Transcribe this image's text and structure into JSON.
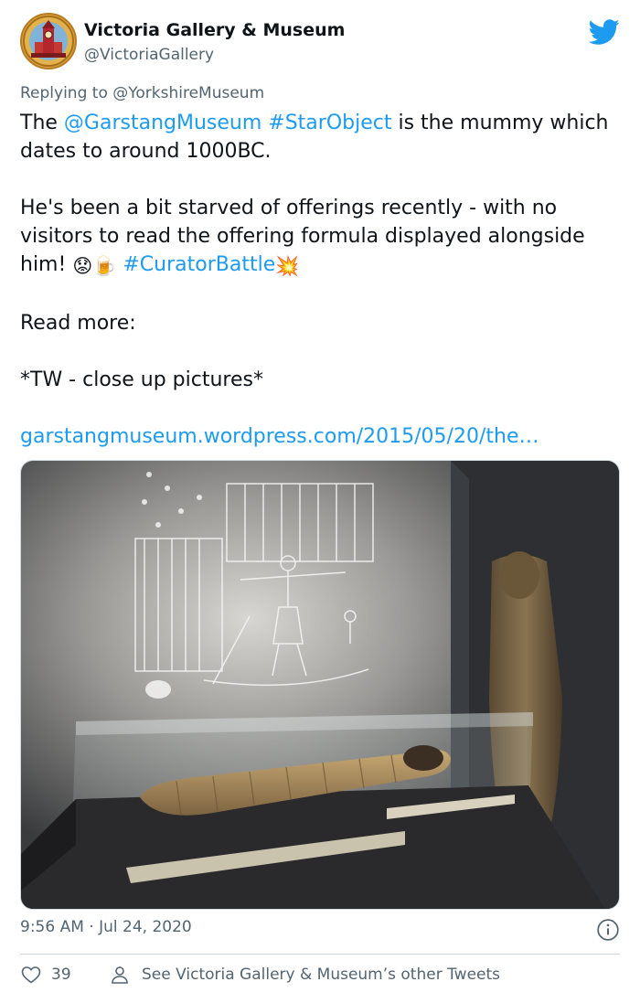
{
  "account": {
    "name": "Victoria Gallery & Museum",
    "handle": "@VictoriaGallery",
    "avatar_icon": "clocktower-logo-icon",
    "platform_icon": "twitter-bird-icon"
  },
  "reply": {
    "prefix": "Replying to ",
    "to": "@YorkshireMuseum"
  },
  "tweet": {
    "p1_prefix": "The ",
    "p1_mention": "@GarstangMuseum",
    "p1_space": " ",
    "p1_hashtag": "#StarObject",
    "p1_rest": " is the mummy which dates to around 1000BC.",
    "p2_text": "He's been a bit starved of offerings recently - with no visitors to read the offering formula displayed alongside him! ",
    "p2_emoji1": "😟",
    "p2_emoji2": "🍺",
    "p2_hashtag": "#CuratorBattle",
    "p2_emoji3": "💥",
    "p3": "Read more:",
    "p4": "*TW - close up pictures*",
    "link": "garstangmuseum.wordpress.com/2015/05/20/the…"
  },
  "photo": {
    "subject": "mummy-in-glass-case-photo"
  },
  "meta": {
    "time": "9:56 AM",
    "separator": " · ",
    "date": "Jul 24, 2020"
  },
  "actions": {
    "like_count": "39",
    "other_tweets_label": "See Victoria Gallery & Museum’s other Tweets"
  },
  "colors": {
    "accent": "#1d9bf0",
    "text": "#0f1419",
    "secondary": "#536471",
    "border": "#cfd9de"
  }
}
